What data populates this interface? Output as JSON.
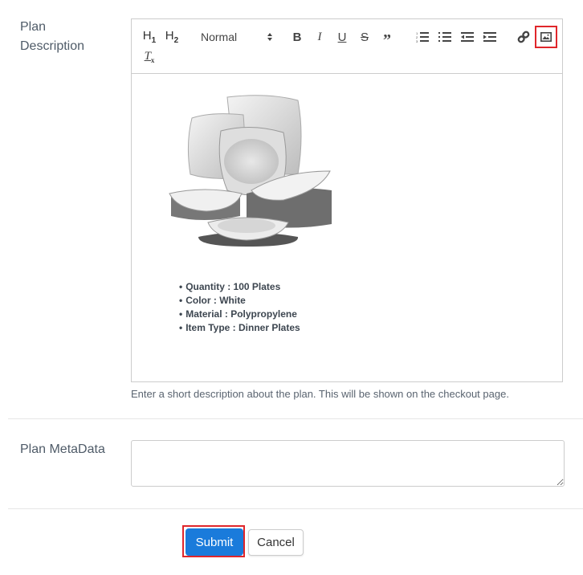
{
  "description_field": {
    "label_line1": "Plan",
    "label_line2": "Description",
    "toolbar": {
      "h1": "H1",
      "h2": "H2",
      "format_select": "Normal",
      "buttons": [
        "bold-icon",
        "italic-icon",
        "underline-icon",
        "strikethrough-icon",
        "blockquote-icon",
        "ordered-list-icon",
        "bullet-list-icon",
        "outdent-icon",
        "indent-icon",
        "link-icon",
        "image-icon",
        "clear-format-icon"
      ]
    },
    "content": {
      "image_alt": "White square dinner plate set",
      "bullets": [
        "Quantity : 100 Plates",
        "Color : White",
        "Material : Polypropylene",
        "Item Type : Dinner Plates"
      ]
    },
    "help_text": "Enter a short description about the plan. This will be shown on the checkout page."
  },
  "metadata_field": {
    "label": "Plan MetaData",
    "value": ""
  },
  "actions": {
    "submit_label": "Submit",
    "cancel_label": "Cancel"
  },
  "colors": {
    "primary": "#1a7bdb",
    "highlight": "#e0262b"
  }
}
